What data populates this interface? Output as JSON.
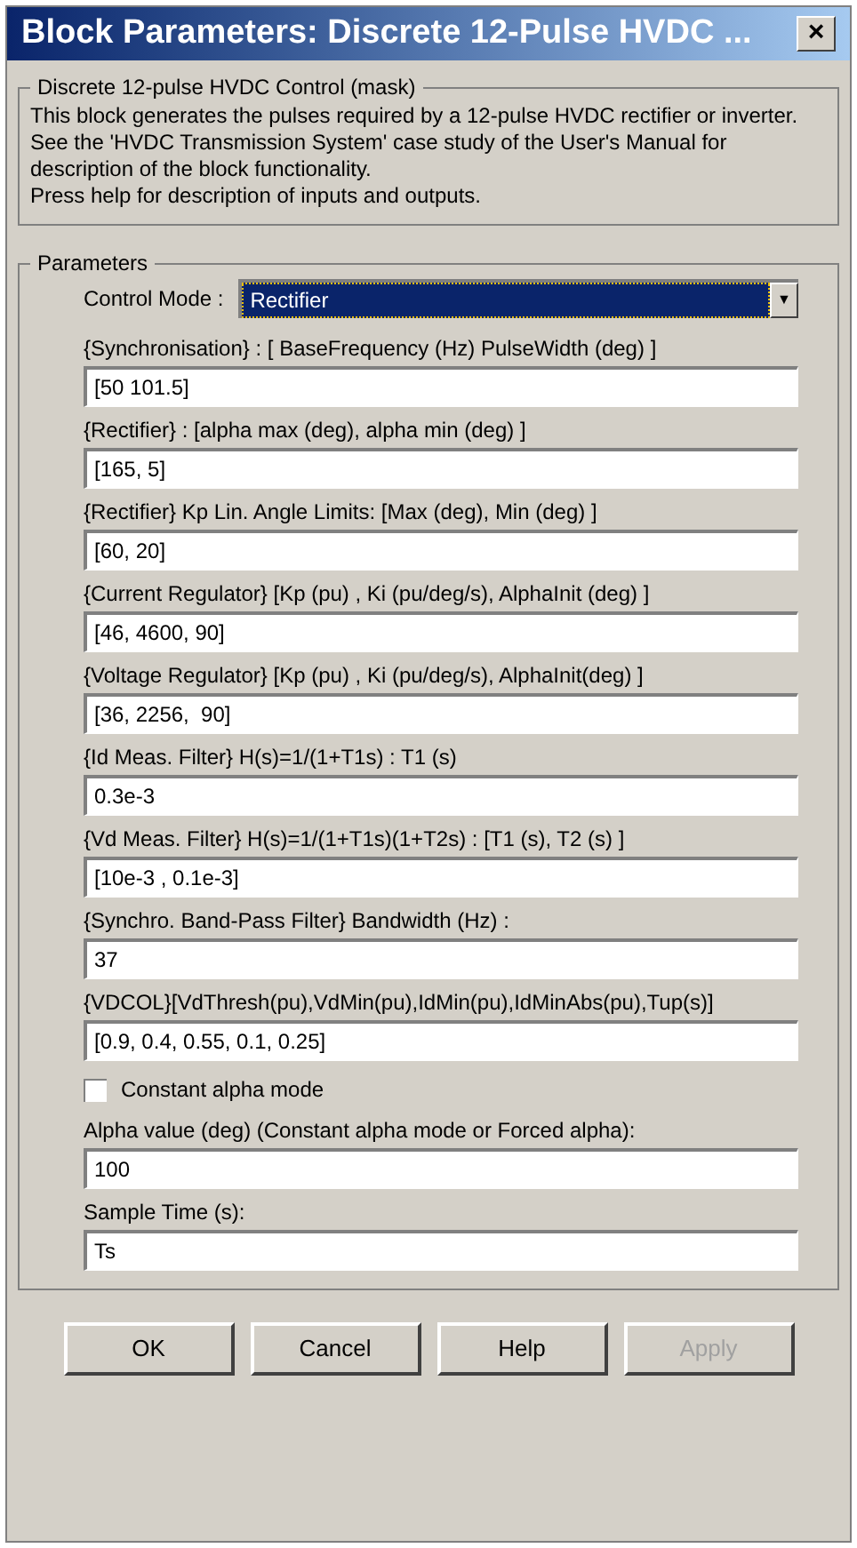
{
  "window": {
    "title": "Block Parameters: Discrete 12-Pulse HVDC ...",
    "close": "×"
  },
  "description": {
    "legend": "Discrete 12-pulse HVDC Control (mask)",
    "lines": [
      "This block generates the pulses required by a 12-pulse HVDC rectifier or inverter.",
      "See the 'HVDC Transmission System' case study of the User's Manual for description of the block functionality.",
      "Press help for description of inputs and outputs."
    ]
  },
  "parameters": {
    "legend": "Parameters",
    "control_mode": {
      "label": "Control Mode :",
      "value": "Rectifier",
      "arrow": "▼"
    },
    "items": [
      {
        "kind": "text",
        "label": "{Synchronisation} : [ BaseFrequency (Hz)  PulseWidth (deg) ]",
        "value": "[50 101.5]"
      },
      {
        "kind": "text",
        "label": "{Rectifier} : [alpha max (deg), alpha min (deg) ]",
        "value": "[165, 5]"
      },
      {
        "kind": "text",
        "label": "{Rectifier} Kp Lin. Angle Limits: [Max  (deg), Min  (deg) ]",
        "value": "[60, 20]"
      },
      {
        "kind": "text",
        "label": "{Current Regulator}   [Kp (pu) , Ki (pu/deg/s), AlphaInit (deg) ]",
        "value": "[46, 4600, 90]"
      },
      {
        "kind": "text",
        "label": "{Voltage Regulator}   [Kp (pu) , Ki (pu/deg/s),  AlphaInit(deg) ]",
        "value": "[36, 2256,  90]"
      },
      {
        "kind": "text",
        "label": "{Id Meas. Filter} H(s)=1/(1+T1s) : T1 (s)",
        "value": "0.3e-3"
      },
      {
        "kind": "text",
        "label": "{Vd Meas. Filter} H(s)=1/(1+T1s)(1+T2s) :  [T1 (s), T2 (s) ]",
        "value": "[10e-3 , 0.1e-3]"
      },
      {
        "kind": "text",
        "label": "{Synchro. Band-Pass Filter}  Bandwidth  (Hz) :",
        "value": "37"
      },
      {
        "kind": "text",
        "label": "{VDCOL}[VdThresh(pu),VdMin(pu),IdMin(pu),IdMinAbs(pu),Tup(s)]",
        "value": "[0.9, 0.4, 0.55, 0.1, 0.25]"
      },
      {
        "kind": "checkbox",
        "label": "Constant alpha mode",
        "checked": false
      },
      {
        "kind": "text",
        "label": "Alpha value (deg) (Constant alpha mode or Forced alpha):",
        "value": "100"
      },
      {
        "kind": "text",
        "label": "Sample Time (s):",
        "value": "Ts"
      }
    ]
  },
  "buttons": [
    {
      "label": "OK",
      "disabled": false
    },
    {
      "label": "Cancel",
      "disabled": false
    },
    {
      "label": "Help",
      "disabled": false
    },
    {
      "label": "Apply",
      "disabled": true
    }
  ]
}
